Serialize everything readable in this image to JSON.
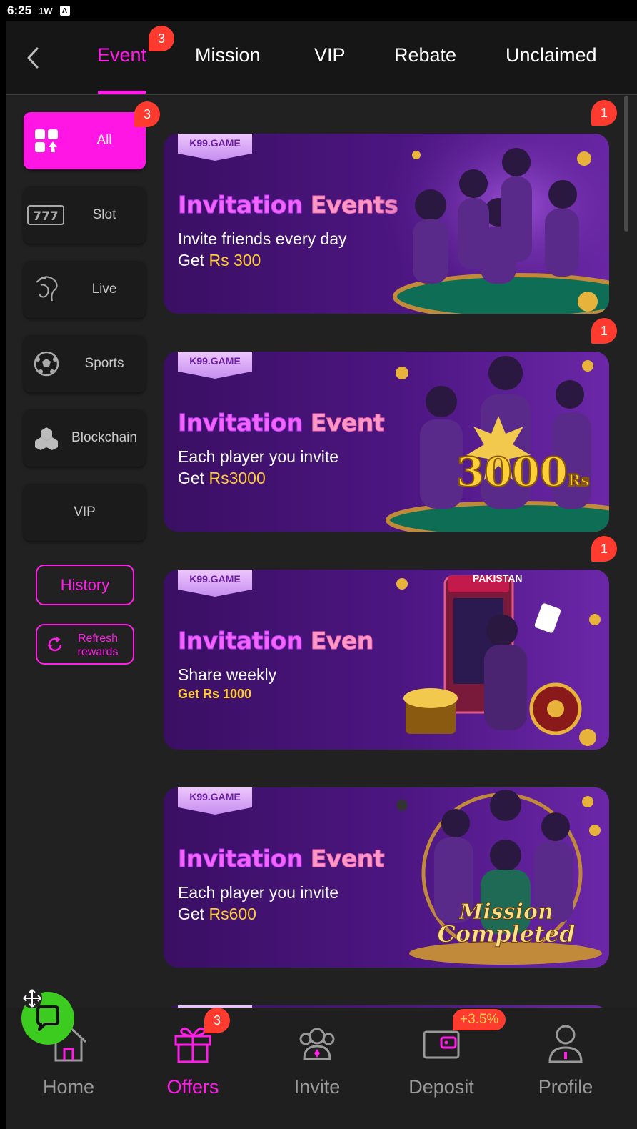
{
  "status_bar": {
    "time": "6:25",
    "icon1": "1W",
    "icon2": "A"
  },
  "top_tabs": [
    {
      "label": "Event",
      "badge": "3",
      "active": true
    },
    {
      "label": "Mission"
    },
    {
      "label": "VIP"
    },
    {
      "label": "Rebate"
    },
    {
      "label": "Unclaimed"
    }
  ],
  "sidebar": {
    "items": [
      {
        "label": "All",
        "icon": "grid-cards-icon",
        "badge": "3",
        "active": true
      },
      {
        "label": "Slot",
        "icon": "slot-777-icon"
      },
      {
        "label": "Live",
        "icon": "live-dealer-icon"
      },
      {
        "label": "Sports",
        "icon": "soccer-ball-icon"
      },
      {
        "label": "Blockchain",
        "icon": "blockchain-icon"
      },
      {
        "label": "VIP"
      }
    ],
    "history_label": "History",
    "refresh_label": "Refresh rewards"
  },
  "banners": [
    {
      "logo": "K99.GAME",
      "title_a": "Invitation",
      "title_b": "Events",
      "line1": "Invite friends every day",
      "line2_prefix": "Get ",
      "line2_amount": "Rs 300",
      "badge": "1"
    },
    {
      "logo": "K99.GAME",
      "title_a": "Invitation",
      "title_b": "Event",
      "line1": "Each player you invite",
      "line2_prefix": "Get ",
      "line2_amount": "Rs3000",
      "art_text": "3000",
      "art_unit": "Rs",
      "badge": "1"
    },
    {
      "logo": "K99.GAME",
      "title_a": "Invitation",
      "title_b": "Even",
      "line1": "Share weekly",
      "line2_prefix": "",
      "line2_amount": "Get Rs 1000",
      "art_text": "PAKISTAN",
      "badge": "1"
    },
    {
      "logo": "K99.GAME",
      "title_a": "Invitation",
      "title_b": "Event",
      "line1": "Each player you invite",
      "line2_prefix": "Get ",
      "line2_amount": "Rs600",
      "art_text": "Mission",
      "art_text2": "Completed"
    }
  ],
  "bottom_nav": [
    {
      "label": "Home",
      "icon": "home-icon"
    },
    {
      "label": "Offers",
      "icon": "gift-icon",
      "badge": "3",
      "active": true
    },
    {
      "label": "Invite",
      "icon": "invite-icon"
    },
    {
      "label": "Deposit",
      "icon": "wallet-icon",
      "badge": "+3.5%"
    },
    {
      "label": "Profile",
      "icon": "profile-icon"
    }
  ],
  "colors": {
    "accent": "#ff1ee8",
    "badge": "#ff3b30",
    "chat": "#3ccb1f",
    "gold": "#ffcc33"
  }
}
